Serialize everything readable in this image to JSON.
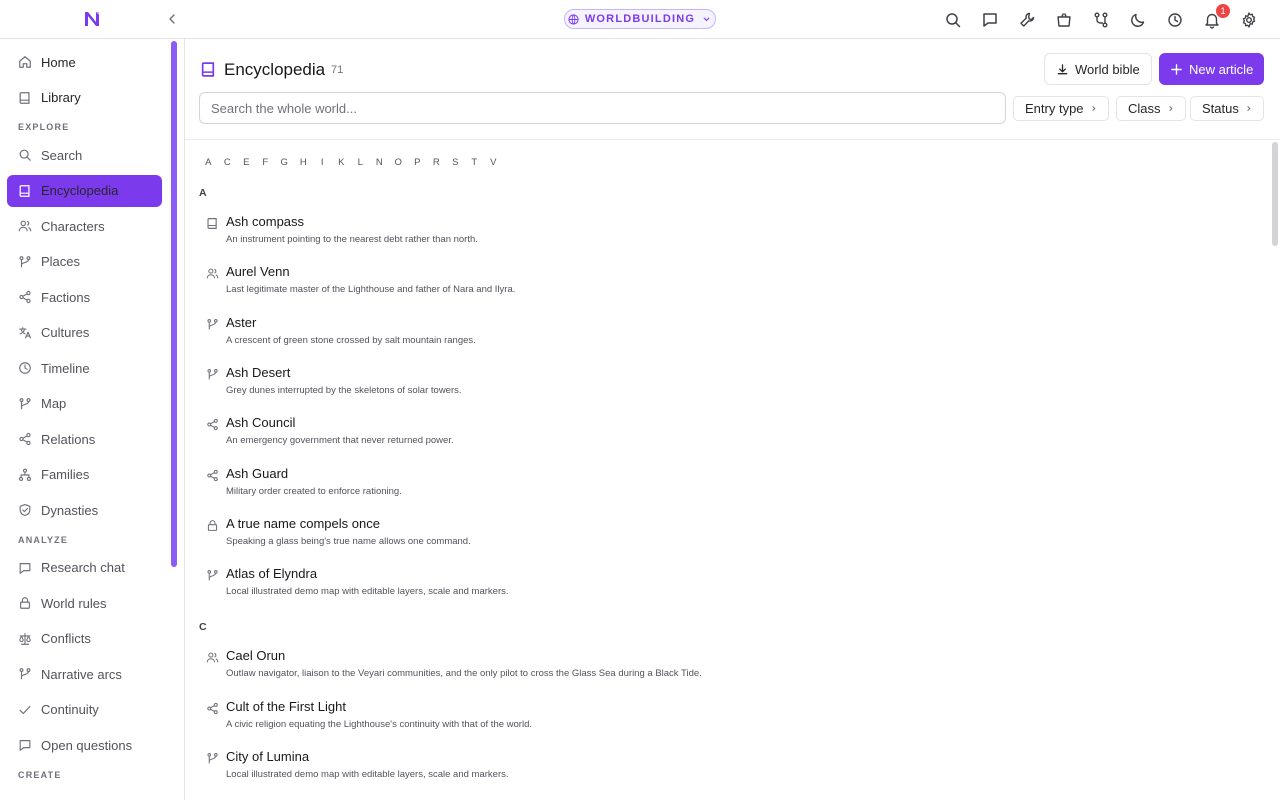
{
  "topbar": {
    "project": "WORLDBUILDING",
    "notification_count": "1",
    "icons": [
      "search-icon",
      "chat-icon",
      "wrench-icon",
      "bag-icon",
      "git-fork-icon",
      "moon-icon",
      "clock-icon",
      "bell-icon",
      "gear-icon"
    ]
  },
  "sidebar": {
    "top_items": [
      {
        "label": "Home",
        "icon": "home-icon"
      },
      {
        "label": "Library",
        "icon": "book-icon"
      }
    ],
    "sections": [
      {
        "title": "EXPLORE",
        "items": [
          {
            "label": "Search",
            "icon": "search-icon"
          },
          {
            "label": "Encyclopedia",
            "icon": "book-icon",
            "active": true
          },
          {
            "label": "Characters",
            "icon": "users-icon"
          },
          {
            "label": "Places",
            "icon": "branch-icon"
          },
          {
            "label": "Factions",
            "icon": "share-icon"
          },
          {
            "label": "Cultures",
            "icon": "translate-icon"
          },
          {
            "label": "Timeline",
            "icon": "clock-icon"
          },
          {
            "label": "Map",
            "icon": "branch-icon"
          },
          {
            "label": "Relations",
            "icon": "share-icon"
          },
          {
            "label": "Families",
            "icon": "family-icon"
          },
          {
            "label": "Dynasties",
            "icon": "shield-icon"
          }
        ]
      },
      {
        "title": "ANALYZE",
        "items": [
          {
            "label": "Research chat",
            "icon": "chat-icon"
          },
          {
            "label": "World rules",
            "icon": "lock-icon"
          },
          {
            "label": "Conflicts",
            "icon": "scales-icon"
          },
          {
            "label": "Narrative arcs",
            "icon": "branch-icon"
          },
          {
            "label": "Continuity",
            "icon": "check-icon"
          },
          {
            "label": "Open questions",
            "icon": "chat-icon"
          }
        ]
      },
      {
        "title": "CREATE",
        "items": []
      }
    ]
  },
  "main": {
    "title": "Encyclopedia",
    "count": "71",
    "world_bible_label": "World bible",
    "new_article_label": "New article",
    "search_placeholder": "Search the whole world...",
    "filters": [
      "Entry type",
      "Class",
      "Status"
    ],
    "letters": [
      "A",
      "C",
      "E",
      "F",
      "G",
      "H",
      "I",
      "K",
      "L",
      "N",
      "O",
      "P",
      "R",
      "S",
      "T",
      "V"
    ],
    "groups": [
      {
        "letter": "A",
        "entries": [
          {
            "title": "Ash compass",
            "desc": "An instrument pointing to the nearest debt rather than north.",
            "icon": "book-icon"
          },
          {
            "title": "Aurel Venn",
            "desc": "Last legitimate master of the Lighthouse and father of Nara and Ilyra.",
            "icon": "users-icon"
          },
          {
            "title": "Aster",
            "desc": "A crescent of green stone crossed by salt mountain ranges.",
            "icon": "branch-icon"
          },
          {
            "title": "Ash Desert",
            "desc": "Grey dunes interrupted by the skeletons of solar towers.",
            "icon": "branch-icon"
          },
          {
            "title": "Ash Council",
            "desc": "An emergency government that never returned power.",
            "icon": "share-icon"
          },
          {
            "title": "Ash Guard",
            "desc": "Military order created to enforce rationing.",
            "icon": "share-icon"
          },
          {
            "title": "A true name compels once",
            "desc": "Speaking a glass being's true name allows one command.",
            "icon": "lock-icon"
          },
          {
            "title": "Atlas of Elyndra",
            "desc": "Local illustrated demo map with editable layers, scale and markers.",
            "icon": "branch-icon"
          }
        ]
      },
      {
        "letter": "C",
        "entries": [
          {
            "title": "Cael Orun",
            "desc": "Outlaw navigator, liaison to the Veyari communities, and the only pilot to cross the Glass Sea during a Black Tide.",
            "icon": "users-icon"
          },
          {
            "title": "Cult of the First Light",
            "desc": "A civic religion equating the Lighthouse's continuity with that of the world.",
            "icon": "share-icon"
          },
          {
            "title": "City of Lumina",
            "desc": "Local illustrated demo map with editable layers, scale and markers.",
            "icon": "branch-icon"
          }
        ]
      }
    ]
  },
  "colors": {
    "accent": "#7c3aed",
    "badge": "#ef4444"
  }
}
